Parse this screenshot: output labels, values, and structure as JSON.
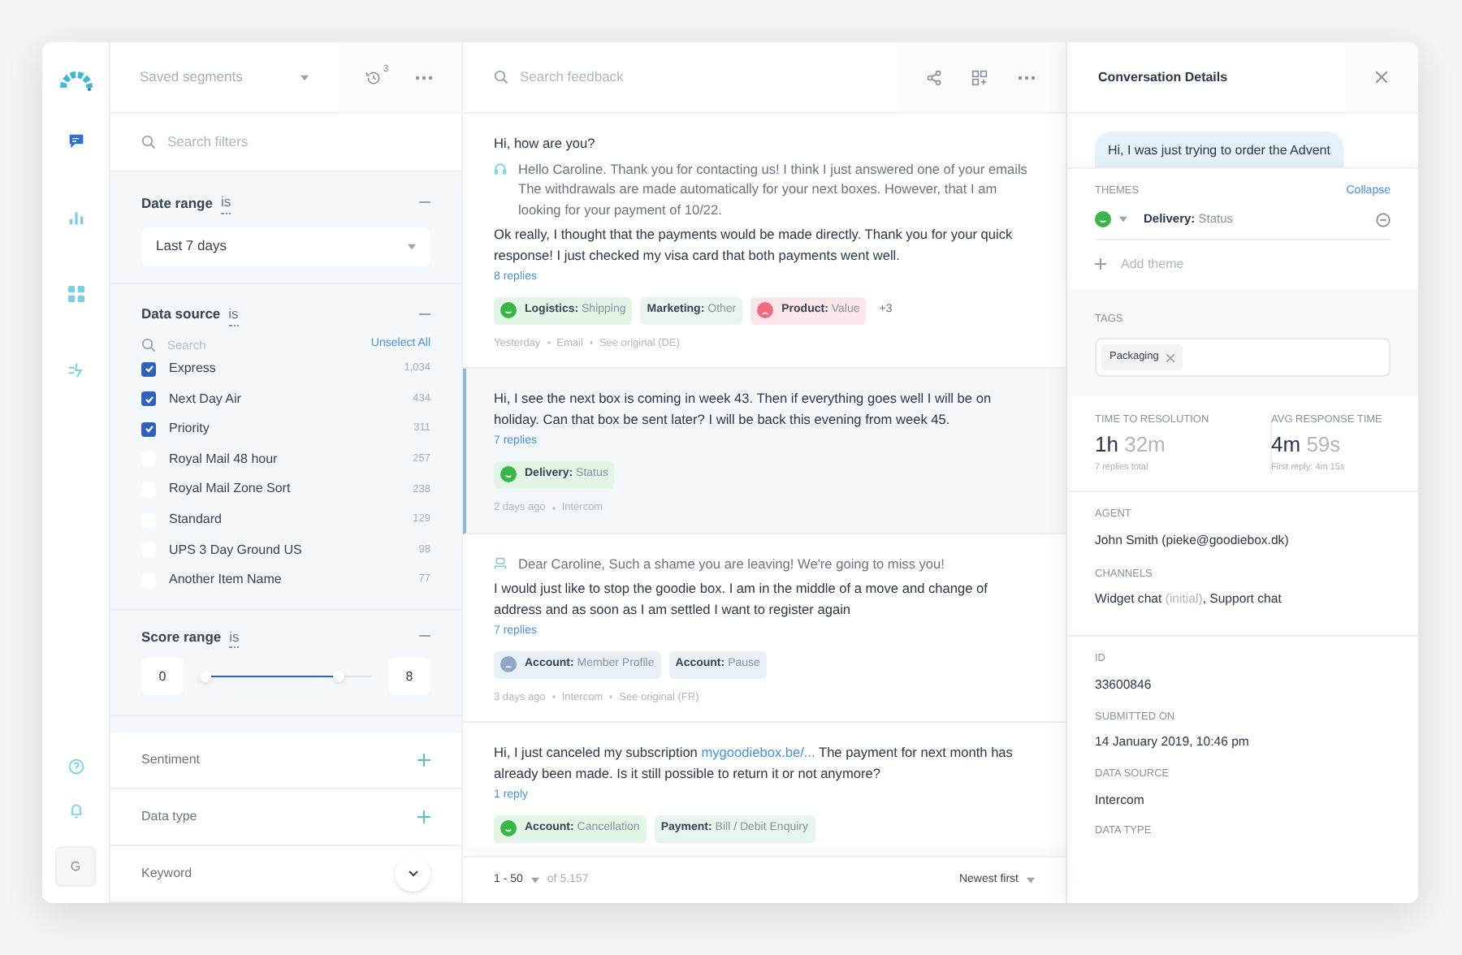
{
  "rail": {
    "items": [
      {
        "kind": "chat",
        "selected": true
      },
      {
        "kind": "chart",
        "selected": false
      },
      {
        "kind": "grid",
        "selected": false
      },
      {
        "kind": "flow",
        "selected": false
      }
    ],
    "bottom": [
      {
        "kind": "help"
      },
      {
        "kind": "bell"
      }
    ],
    "avatar": "G"
  },
  "segments": {
    "label": "Saved segments",
    "history_count": "3"
  },
  "filters": {
    "search_placeholder": "Search filters",
    "date_range": {
      "label": "Date range",
      "operator": "is",
      "value": "Last 7 days"
    },
    "data_source": {
      "label": "Data source",
      "operator": "is",
      "search_placeholder": "Search",
      "unselect": "Unselect All",
      "items": [
        {
          "name": "Express",
          "count": "1,034",
          "checked": true
        },
        {
          "name": "Next Day Air",
          "count": "434",
          "checked": true
        },
        {
          "name": "Priority",
          "count": "311",
          "checked": true
        },
        {
          "name": "Royal Mail 48 hour",
          "count": "257",
          "checked": false
        },
        {
          "name": "Royal Mail Zone Sort",
          "count": "238",
          "checked": false
        },
        {
          "name": "Standard",
          "count": "129",
          "checked": false
        },
        {
          "name": "UPS 3 Day Ground US",
          "count": "98",
          "checked": false
        },
        {
          "name": "Another Item Name",
          "count": "77",
          "checked": false
        }
      ]
    },
    "score_range": {
      "label": "Score range",
      "operator": "is",
      "min": "0",
      "max": "8",
      "level": 0.8
    },
    "collapsed": [
      {
        "label": "Sentiment"
      },
      {
        "label": "Data type"
      },
      {
        "label": "Keyword"
      }
    ]
  },
  "feed": {
    "search_placeholder": "Search feedback",
    "items": [
      {
        "selected": false,
        "lines": [
          {
            "kind": "customer",
            "parts": [
              {
                "text": "Hi, how are you?"
              }
            ]
          },
          {
            "kind": "agent",
            "parts": [
              {
                "text": "Hello Caroline. Thank you for contacting us! I think I just answered one of your emails The withdrawals are made automatically for your next boxes. However, that I am looking for your payment of 10/22."
              }
            ]
          },
          {
            "kind": "customer",
            "parts": [
              {
                "text": "Ok really, I thought that the payments would be made directly. Thank you for your quick response! I just checked my visa card that both payments went well."
              }
            ]
          }
        ],
        "replies": "8 replies",
        "tags": [
          {
            "kind": "positive",
            "color": "#e3f5e6",
            "category": "Logistics:",
            "value": "Shipping"
          },
          {
            "kind": "none",
            "color": "#e8f4ee",
            "category": "Marketing:",
            "value": "Other"
          },
          {
            "kind": "negative",
            "color": "#fce6ea",
            "category": "Product:",
            "value": "Value"
          }
        ],
        "more": "+3",
        "meta": [
          "Yesterday",
          "Email",
          "See original (DE)"
        ]
      },
      {
        "selected": true,
        "lines": [
          {
            "kind": "customer",
            "parts": [
              {
                "text": "Hi, I see the next box is coming in week 43. Then if everything goes well I will be on holiday. Can that box be sent later? I will be back this evening from week 45."
              }
            ]
          }
        ],
        "replies": "7 replies",
        "tags": [
          {
            "kind": "positive",
            "color": "#e3f5e6",
            "category": "Delivery:",
            "value": "Status"
          }
        ],
        "meta": [
          "2 days ago",
          "Intercom"
        ]
      },
      {
        "selected": false,
        "lines": [
          {
            "kind": "bot",
            "parts": [
              {
                "text": "Dear Caroline, Such a shame you are leaving! We're going to miss you!"
              }
            ]
          },
          {
            "kind": "customer",
            "parts": [
              {
                "text": "I would just like to stop the goodie box. I am in the middle of a move and change of address and as soon as I am settled I want to register again"
              }
            ]
          }
        ],
        "replies": "7 replies",
        "tags": [
          {
            "kind": "neutral",
            "color": "#eaf0f7",
            "category": "Account:",
            "value": "Member Profile"
          },
          {
            "kind": "none",
            "color": "#eaf0f7",
            "category": "Account:",
            "value": "Pause"
          }
        ],
        "meta": [
          "3 days ago",
          "Intercom",
          "See original (FR)"
        ]
      },
      {
        "selected": false,
        "lines": [
          {
            "kind": "customer",
            "parts": [
              {
                "text": "Hi, I just canceled my subscription "
              },
              {
                "text": "mygoodiebox.be/...",
                "link": true
              },
              {
                "text": " The payment for next month has already been made. Is it still possible to return it or not anymore?"
              }
            ]
          }
        ],
        "replies": "1 reply",
        "tags": [
          {
            "kind": "positive",
            "color": "#e3f5e6",
            "category": "Account:",
            "value": "Cancellation"
          },
          {
            "kind": "none",
            "color": "#e8f4ee",
            "category": "Payment:",
            "value": "Bill / Debit Enquiry"
          }
        ]
      }
    ],
    "pagination": {
      "range": "1 - 50",
      "total": "of 5,157",
      "sort": "Newest first"
    }
  },
  "details": {
    "title": "Conversation Details",
    "bubble": "Hi, I was just trying to order the Advent",
    "themes": {
      "label": "THEMES",
      "action": "Collapse",
      "items": [
        {
          "kind": "positive",
          "category": "Delivery:",
          "value": "Status"
        }
      ],
      "add": "Add theme"
    },
    "tags": {
      "label": "TAGS",
      "items": [
        "Packaging"
      ]
    },
    "stats": [
      {
        "label": "TIME TO RESOLUTION",
        "major": "1h",
        "minor": "32m",
        "note": "7 replies total"
      },
      {
        "label": "AVG RESPONSE TIME",
        "major": "4m",
        "minor": "59s",
        "note": "First reply: 4m 15s"
      }
    ],
    "fields": [
      {
        "label": "AGENT",
        "parts": [
          {
            "text": "John Smith (pieke@goodiebox.dk)",
            "muted": false
          }
        ]
      },
      {
        "label": "CHANNELS",
        "parts": [
          {
            "text": "Widget chat ",
            "muted": false
          },
          {
            "text": "(initial)",
            "muted": true
          },
          {
            "text": ", Support chat",
            "muted": false
          }
        ]
      }
    ],
    "fields2": [
      {
        "label": "ID",
        "value": "33600846"
      },
      {
        "label": "SUBMITTED ON",
        "value": "14 January 2019, 10:46 pm"
      },
      {
        "label": "DATA SOURCE",
        "value": "Intercom"
      },
      {
        "label": "DATA TYPE"
      }
    ]
  }
}
